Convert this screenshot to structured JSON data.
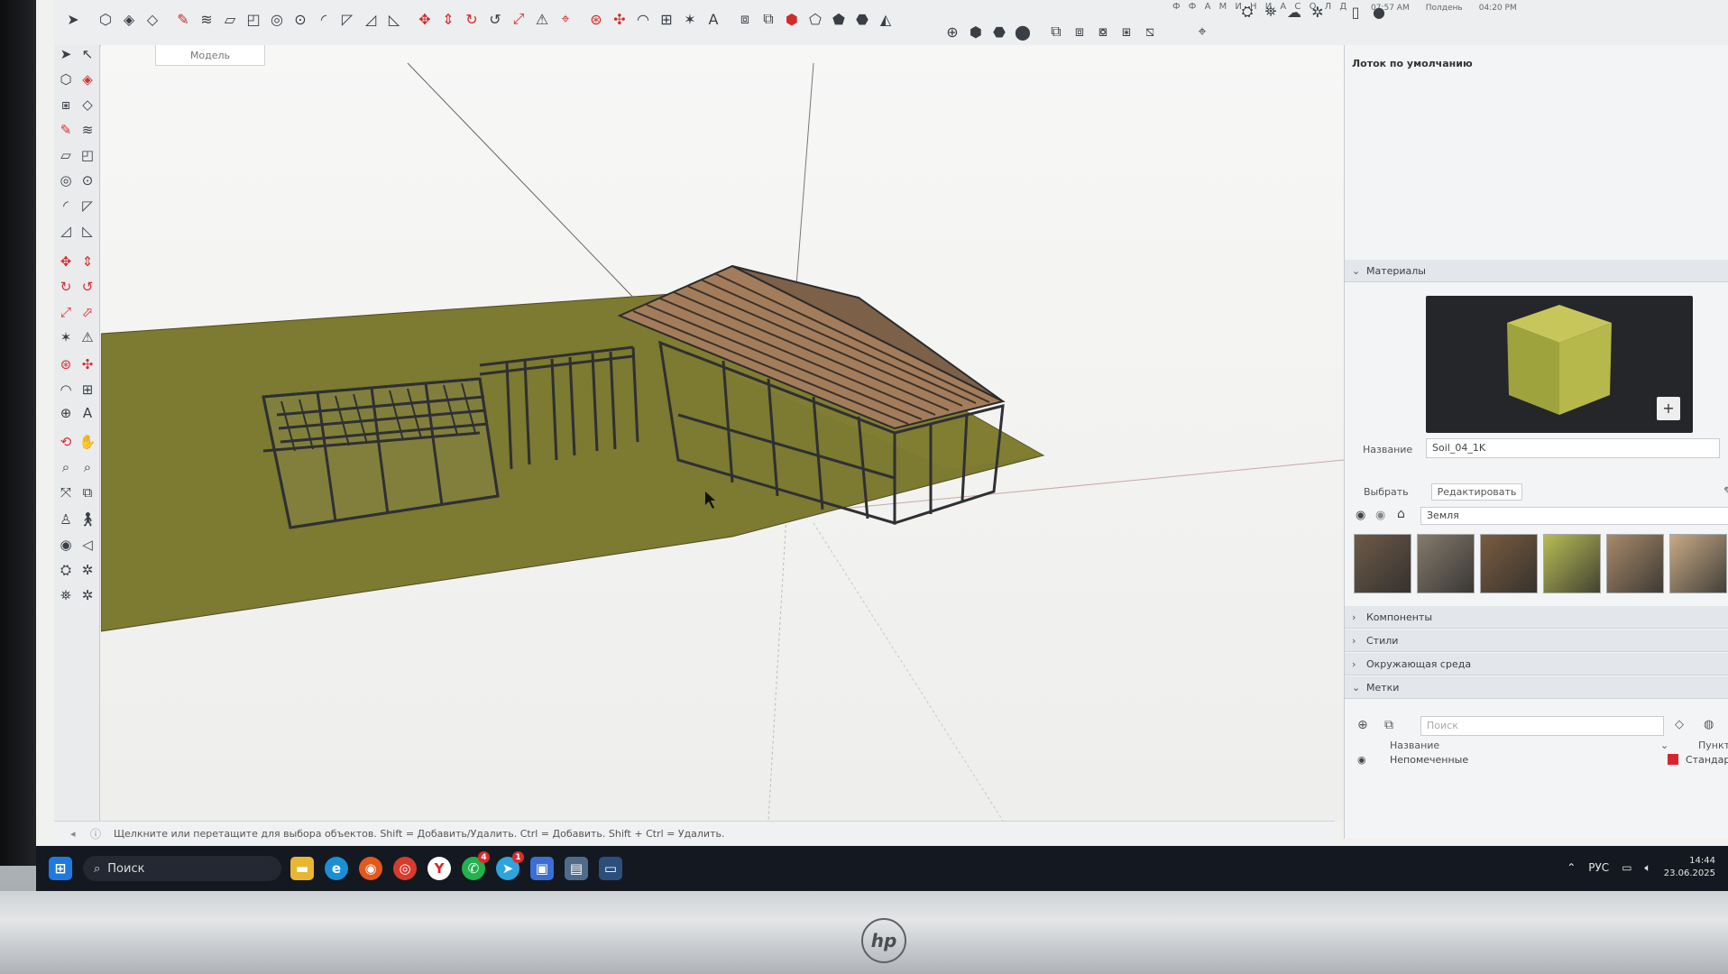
{
  "top_bar": {
    "clock_strip": "Ф Ф А М И Н И А С О Л Д",
    "time_left": "07:57 AM",
    "time_label": "Полдень",
    "time_right": "04:20 PM"
  },
  "viewport": {
    "tab_label": "Модель"
  },
  "status_bar": {
    "hint": "Щелкните или перетащите для выбора объектов. Shift = Добавить/Удалить. Ctrl = Добавить. Shift + Ctrl = Удалить."
  },
  "right_panel": {
    "tray_title": "Лоток по умолчанию",
    "materials": {
      "header": "Материалы",
      "name_label": "Название",
      "name_value": "Soil_04_1K",
      "tab_select": "Выбрать",
      "tab_edit": "Редактировать",
      "collection": "Земля",
      "swatch_colors": [
        "#6d5a48",
        "#857a6c",
        "#7a5c40",
        "#b8bd55",
        "#a88a6a",
        "#c7aa86"
      ]
    },
    "sections": [
      "Компоненты",
      "Стили",
      "Окружающая среда"
    ],
    "tags": {
      "header": "Метки",
      "search_placeholder": "Поиск",
      "col_name": "Название",
      "col_dash": "Пунктир",
      "row_name": "Непомеченные",
      "row_dash": "Стандарт",
      "row_color": "#d8242c"
    }
  },
  "taskbar": {
    "search_label": "Поиск",
    "lang": "РУС",
    "time": "14:44",
    "date": "23.06.2025",
    "badges": {
      "whatsapp": "4",
      "telegram": "1"
    }
  },
  "monitor": {
    "brand": "hp"
  }
}
